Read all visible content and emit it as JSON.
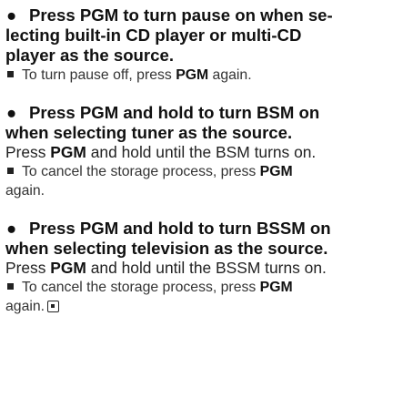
{
  "bullet_symbol": "●",
  "sections": [
    {
      "heading": [
        "Press PGM to turn pause on when se-",
        "lecting built-in CD player or multi-CD",
        "player as the source."
      ],
      "note": {
        "prefix": "To turn pause off, press ",
        "keyword": "PGM",
        "suffix": " again."
      }
    },
    {
      "heading": [
        "Press PGM and hold to turn BSM on",
        "when selecting tuner as the source."
      ],
      "body": {
        "prefix": "Press ",
        "keyword": "PGM",
        "suffix": " and hold until the BSM turns on."
      },
      "note": {
        "prefix": "To cancel the storage process, press ",
        "keyword": "PGM",
        "continuation": "again."
      }
    },
    {
      "heading": [
        "Press PGM and hold to turn BSSM on",
        "when selecting television as the source."
      ],
      "body": {
        "prefix": "Press ",
        "keyword": "PGM",
        "suffix": " and hold until the BSSM turns on."
      },
      "note": {
        "prefix": "To cancel the storage process, press ",
        "keyword": "PGM",
        "continuation": "again."
      }
    }
  ]
}
